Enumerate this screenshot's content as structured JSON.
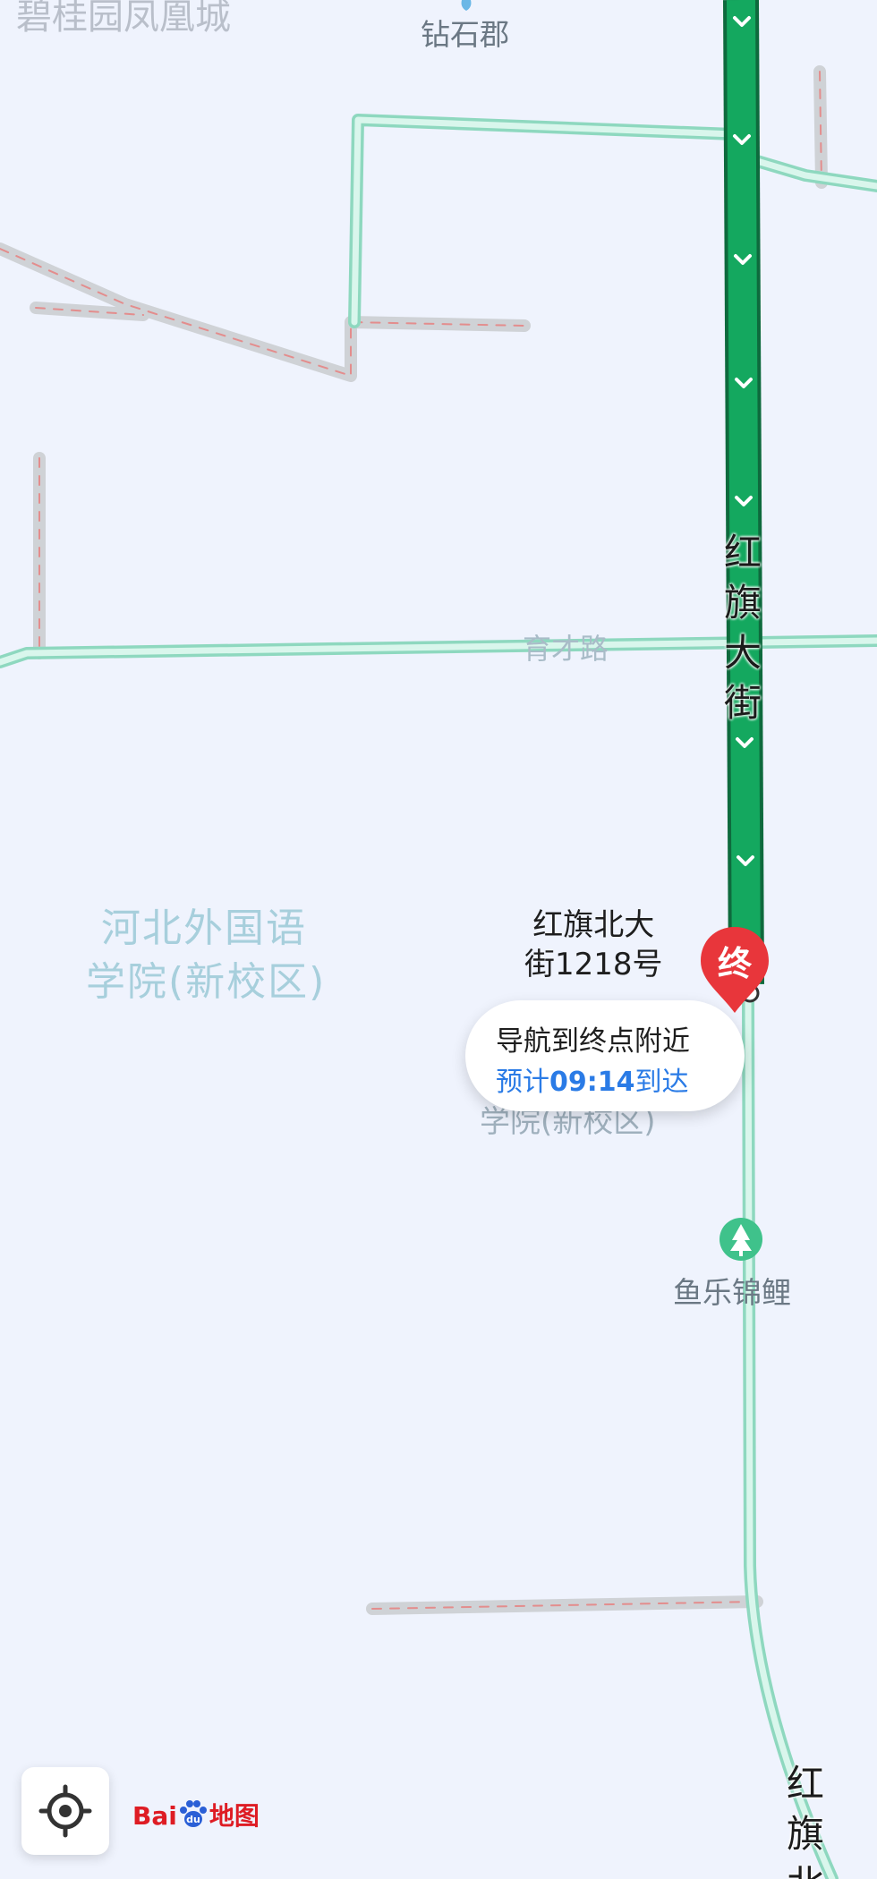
{
  "map": {
    "area_labels": {
      "top_left": "碧桂园凤凰城",
      "college_line1": "河北外国语",
      "college_line2": "学院(新校区)",
      "college_faded": "学院(新校区)"
    },
    "poi": {
      "top": "钻石郡",
      "park": "鱼乐锦鲤"
    },
    "roads": {
      "yucai": "育才路",
      "hongqi_main": [
        "红",
        "旗",
        "大",
        "街"
      ],
      "hongqi_north": [
        "红",
        "旗",
        "北"
      ]
    },
    "destination": {
      "address_line1": "红旗北大",
      "address_line2": "街1218号",
      "pin_text": "终"
    },
    "callout": {
      "title": "导航到终点附近",
      "eta_prefix": "预计",
      "eta_time": "09:14",
      "eta_suffix": "到达"
    },
    "brand": {
      "text_bai": "Bai",
      "text_du": "du",
      "text_map": "地图"
    },
    "colors": {
      "route_green": "#14a85f",
      "road_mint": "#a9e6d2",
      "pin_red": "#e8363b",
      "eta_blue": "#2a7be6"
    },
    "icons": {
      "locate": "target-crosshair-icon",
      "park": "tree-icon",
      "route_arrow": "chevron-down-icon"
    }
  }
}
